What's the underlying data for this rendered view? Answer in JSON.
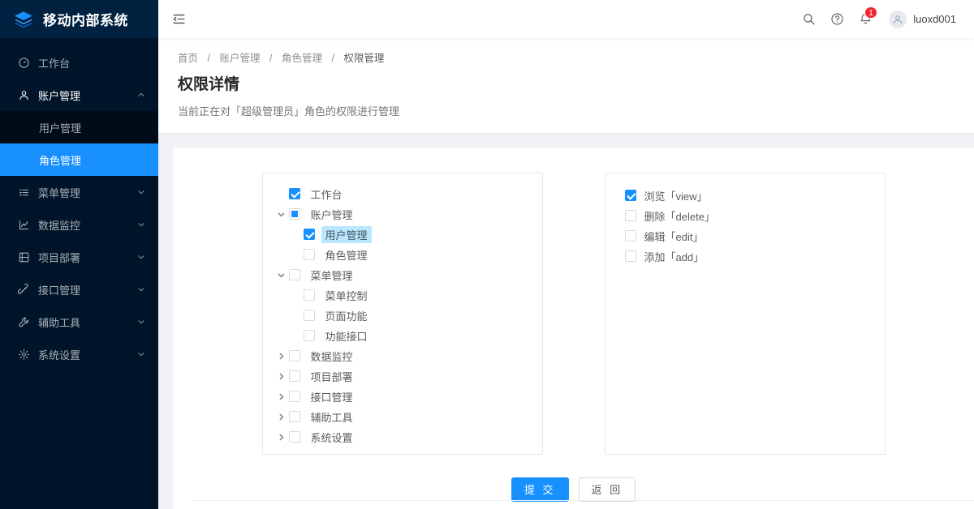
{
  "brand": {
    "title": "移动内部系统",
    "logo_icon": "layers-icon",
    "accent_color": "#1890ff",
    "sider_bg": "#001529",
    "submenu_bg": "#000c17"
  },
  "sidebar": {
    "items": [
      {
        "label": "工作台",
        "icon": "dashboard-icon",
        "name": "workbench",
        "has_arrow": false,
        "expanded": false
      },
      {
        "label": "账户管理",
        "icon": "user-icon",
        "name": "account-management",
        "has_arrow": true,
        "expanded": true,
        "children": [
          {
            "label": "用户管理",
            "name": "user-management",
            "active": false
          },
          {
            "label": "角色管理",
            "name": "role-management",
            "active": true
          }
        ]
      },
      {
        "label": "菜单管理",
        "icon": "list-icon",
        "name": "menu-management",
        "has_arrow": true,
        "expanded": false
      },
      {
        "label": "数据监控",
        "icon": "chart-icon",
        "name": "data-monitoring",
        "has_arrow": true,
        "expanded": false
      },
      {
        "label": "项目部署",
        "icon": "deploy-icon",
        "name": "project-deployment",
        "has_arrow": true,
        "expanded": false
      },
      {
        "label": "接口管理",
        "icon": "api-icon",
        "name": "api-management",
        "has_arrow": true,
        "expanded": false
      },
      {
        "label": "辅助工具",
        "icon": "tool-icon",
        "name": "utility-tools",
        "has_arrow": true,
        "expanded": false
      },
      {
        "label": "系统设置",
        "icon": "gear-icon",
        "name": "system-settings",
        "has_arrow": true,
        "expanded": false
      }
    ]
  },
  "topbar": {
    "trigger_icon": "menu-fold-icon",
    "search_icon": "search-icon",
    "help_icon": "question-circle-icon",
    "bell_icon": "bell-icon",
    "notification_count": "1",
    "avatar_icon": "avatar-icon",
    "username": "luoxd001"
  },
  "pageheader": {
    "breadcrumb": [
      "首页",
      "账户管理",
      "角色管理",
      "权限管理"
    ],
    "separator": "/",
    "title": "权限详情",
    "description": "当前正在对「超级管理员」角色的权限进行管理"
  },
  "permission_tree": {
    "nodes": [
      {
        "label": "工作台",
        "indent": 0,
        "switcher": "none",
        "check": "checked",
        "selected": false,
        "name": "tree-node-workbench"
      },
      {
        "label": "账户管理",
        "indent": 0,
        "switcher": "collapse",
        "check": "indeterminate",
        "selected": false,
        "name": "tree-node-account-management"
      },
      {
        "label": "用户管理",
        "indent": 1,
        "switcher": "none",
        "check": "checked",
        "selected": true,
        "name": "tree-node-user-management"
      },
      {
        "label": "角色管理",
        "indent": 1,
        "switcher": "none",
        "check": "unchecked",
        "selected": false,
        "name": "tree-node-role-management"
      },
      {
        "label": "菜单管理",
        "indent": 0,
        "switcher": "collapse",
        "check": "unchecked",
        "selected": false,
        "name": "tree-node-menu-management"
      },
      {
        "label": "菜单控制",
        "indent": 1,
        "switcher": "none",
        "check": "unchecked",
        "selected": false,
        "name": "tree-node-menu-control"
      },
      {
        "label": "页面功能",
        "indent": 1,
        "switcher": "none",
        "check": "unchecked",
        "selected": false,
        "name": "tree-node-page-function"
      },
      {
        "label": "功能接口",
        "indent": 1,
        "switcher": "none",
        "check": "unchecked",
        "selected": false,
        "name": "tree-node-function-api"
      },
      {
        "label": "数据监控",
        "indent": 0,
        "switcher": "expand",
        "check": "unchecked",
        "selected": false,
        "name": "tree-node-data-monitoring"
      },
      {
        "label": "项目部署",
        "indent": 0,
        "switcher": "expand",
        "check": "unchecked",
        "selected": false,
        "name": "tree-node-project-deployment"
      },
      {
        "label": "接口管理",
        "indent": 0,
        "switcher": "expand",
        "check": "unchecked",
        "selected": false,
        "name": "tree-node-api-management"
      },
      {
        "label": "辅助工具",
        "indent": 0,
        "switcher": "expand",
        "check": "unchecked",
        "selected": false,
        "name": "tree-node-utility-tools"
      },
      {
        "label": "系统设置",
        "indent": 0,
        "switcher": "expand",
        "check": "unchecked",
        "selected": false,
        "name": "tree-node-system-settings"
      }
    ]
  },
  "permission_actions": {
    "items": [
      {
        "label": "浏览「view」",
        "check": "checked",
        "name": "permission-view"
      },
      {
        "label": "删除「delete」",
        "check": "unchecked",
        "name": "permission-delete"
      },
      {
        "label": "编辑「edit」",
        "check": "unchecked",
        "name": "permission-edit"
      },
      {
        "label": "添加「add」",
        "check": "unchecked",
        "name": "permission-add"
      }
    ]
  },
  "footer_actions": {
    "submit_label": "提 交",
    "back_label": "返 回"
  }
}
